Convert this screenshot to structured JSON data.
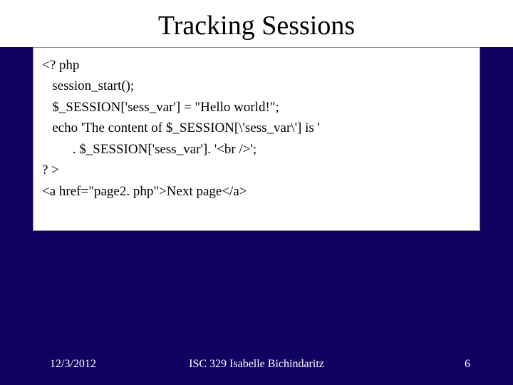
{
  "title": "Tracking Sessions",
  "code": {
    "l1": "<? php",
    "l2": "   session_start();",
    "l3": "",
    "l4": "   $_SESSION['sess_var'] = \"Hello world!\";",
    "l5": "",
    "l6": "   echo 'The content of $_SESSION[\\'sess_var\\'] is '",
    "l7": "         . $_SESSION['sess_var']. '<br />';",
    "l8": "? >",
    "l9": "<a href=\"page2. php\">Next page</a>"
  },
  "footer": {
    "date": "12/3/2012",
    "course": "ISC 329   Isabelle Bichindaritz",
    "page": "6"
  }
}
